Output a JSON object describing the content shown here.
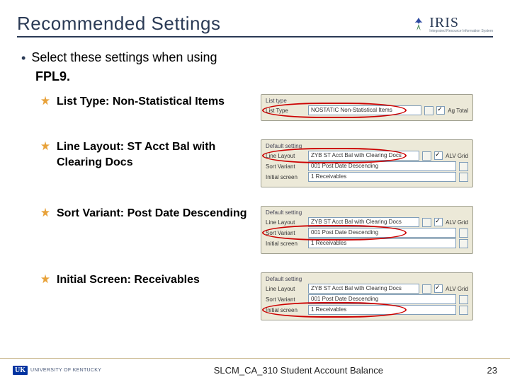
{
  "header": {
    "title": "Recommended Settings",
    "logo_text": "IRIS",
    "logo_sub": "Integrated Resource Information System"
  },
  "intro": {
    "text": "Select these settings when using",
    "tcode": "FPL9."
  },
  "items": [
    {
      "label": "List Type:  Non-Statistical Items",
      "panel": {
        "title": "List type",
        "rows": [
          {
            "lab": "List Type",
            "val": "NOSTATIC Non-Statistical Items",
            "tail_check": true,
            "tail": "Ag Total",
            "ring": true
          }
        ]
      }
    },
    {
      "label": "Line Layout: ST Acct Bal with Clearing Docs",
      "panel": {
        "title": "Default setting",
        "rows": [
          {
            "lab": "Line Layout",
            "val": "ZYB ST Acct Bal with Clearing Docs",
            "tail_check": true,
            "tail": "ALV Grid",
            "ring": true
          },
          {
            "lab": "Sort Variant",
            "val": "001 Post Date Descending"
          },
          {
            "lab": "Initial screen",
            "val": "1 Receivables"
          }
        ]
      }
    },
    {
      "label": "Sort Variant: Post Date Descending",
      "panel": {
        "title": "Default setting",
        "rows": [
          {
            "lab": "Line Layout",
            "val": "ZYB ST Acct Bal with Clearing Docs",
            "tail_check": true,
            "tail": "ALV Grid"
          },
          {
            "lab": "Sort Variant",
            "val": "001 Post Date Descending",
            "ring": true
          },
          {
            "lab": "Initial screen",
            "val": "1 Receivables"
          }
        ]
      }
    },
    {
      "label": "Initial Screen: Receivables",
      "panel": {
        "title": "Default setting",
        "rows": [
          {
            "lab": "Line Layout",
            "val": "ZYB ST Acct Bal with Clearing Docs",
            "tail_check": true,
            "tail": "ALV Grid"
          },
          {
            "lab": "Sort Variant",
            "val": "001 Post Date Descending"
          },
          {
            "lab": "Initial screen",
            "val": "1 Receivables",
            "ring": true
          }
        ]
      }
    }
  ],
  "footer": {
    "uk": "UK",
    "uk_text": "UNIVERSITY OF KENTUCKY",
    "title": "SLCM_CA_310 Student Account Balance",
    "page": "23"
  }
}
